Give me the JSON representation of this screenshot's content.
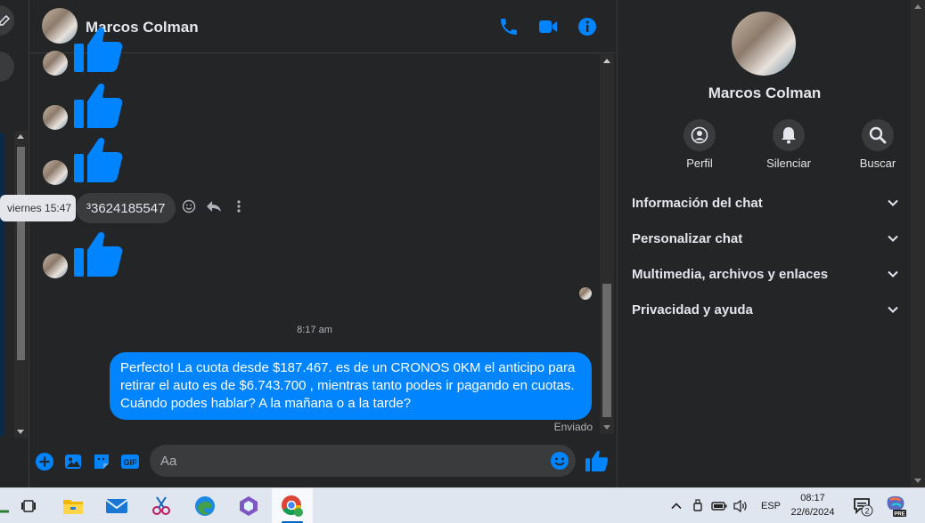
{
  "contact": {
    "name": "Marcos Colman"
  },
  "conversation": {
    "timestamp_tooltip": "viernes 15:47",
    "phone_message": "³3624185547",
    "time_divider": "8:17 am",
    "outgoing_message": "Perfecto! La cuota desde $187.467. es de un CRONOS 0KM el anticipo para retirar el auto es de $6.743.700 , mientras tanto podes ir pagando en cuotas. Cuándo podes hablar? A la mañana o a la tarde?",
    "status": "Enviado"
  },
  "composer": {
    "placeholder": "Aa",
    "gif_label": "GIF"
  },
  "panel": {
    "actions": [
      {
        "label": "Perfil",
        "icon": "profile-icon"
      },
      {
        "label": "Silenciar",
        "icon": "bell-icon"
      },
      {
        "label": "Buscar",
        "icon": "search-icon"
      }
    ],
    "sections": [
      {
        "label": "Información del chat"
      },
      {
        "label": "Personalizar chat"
      },
      {
        "label": "Multimedia, archivos y enlaces"
      },
      {
        "label": "Privacidad y ayuda"
      }
    ]
  },
  "taskbar": {
    "language": "ESP",
    "time": "08:17",
    "date": "22/6/2024",
    "notification_count": "2",
    "copilot_badge": "PRE"
  },
  "colors": {
    "accent": "#0084ff",
    "background": "#242526",
    "bubble_in": "#3a3b3c",
    "taskbar": "#dfe6ef"
  }
}
